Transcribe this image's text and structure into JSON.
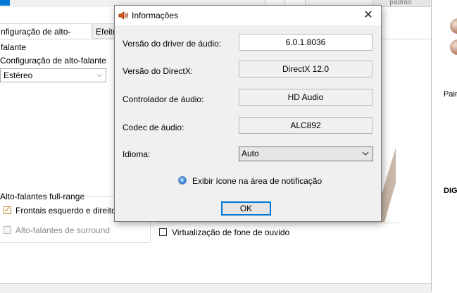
{
  "background": {
    "top_tab_partial": "padrão",
    "tabs": [
      "nfiguração de alto-falante",
      "Efeito"
    ],
    "speaker_config_label": "Configuração de alto-falante",
    "speaker_config_value": "Estéreo",
    "fullrange_label": "Alto-falantes full-range",
    "front_checkbox_label": "Frontais esquerdo e direito",
    "surround_checkbox_label": "Alto-falantes de surround",
    "virtualization_label": "Virtualização de fone de ouvido",
    "right_pane_text": "Pain",
    "right_pane_bold": "DIG"
  },
  "dialog": {
    "title": "Informações",
    "close_glyph": "✕",
    "rows": [
      {
        "label": "Versão do driver de áudio:",
        "value": "6.0.1.8036"
      },
      {
        "label": "Versão do DirectX:",
        "value": "DirectX 12.0"
      },
      {
        "label": "Controlador de áudio:",
        "value": "HD Audio"
      },
      {
        "label": "Codec de áudio:",
        "value": "ALC892"
      }
    ],
    "language_label": "Idioma:",
    "language_value": "Auto",
    "tray_option_label": "Exibir ícone na área de notificação",
    "ok_label": "OK"
  },
  "colors": {
    "accent": "#0078d7",
    "dialog_bg": "#f0f0f0",
    "checkbox_check": "#c07a1a"
  }
}
